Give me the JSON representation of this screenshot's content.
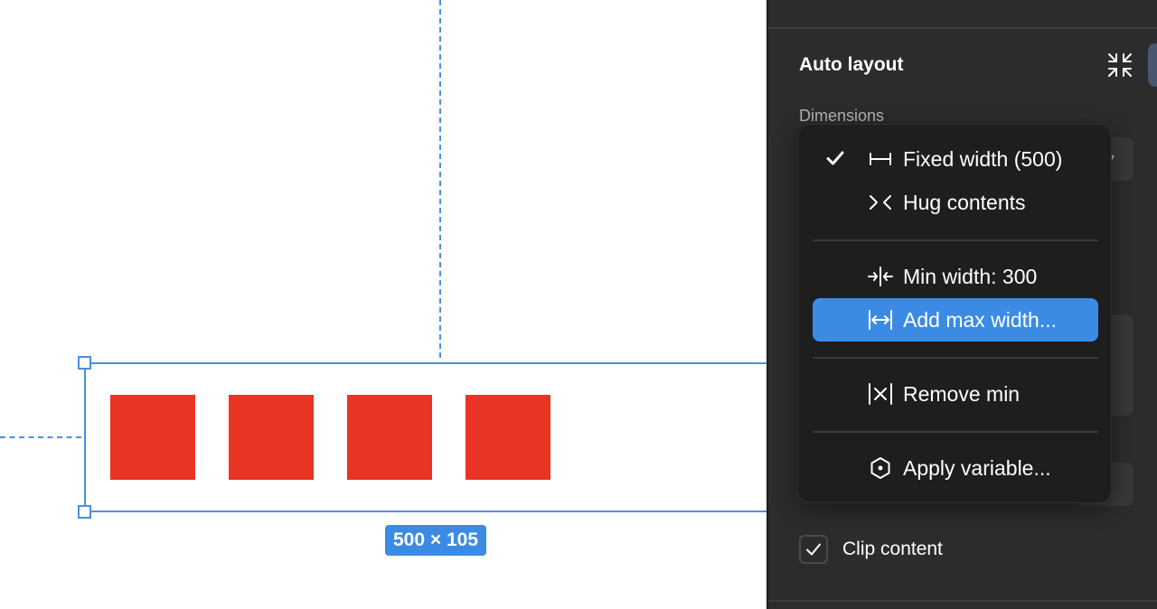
{
  "canvas": {
    "selection_size": "500 × 105",
    "fill_color": "#e93323",
    "accent_color": "#3b8be4",
    "square_count": 4
  },
  "panel": {
    "title": "Auto layout",
    "collapse_icon": "collapse-arrows-icon",
    "dimensions_label": "Dimensions",
    "clip_content": {
      "label": "Clip content",
      "checked": true
    }
  },
  "menu": {
    "items": [
      {
        "label": "Fixed width (500)",
        "icon": "fixed-width-icon",
        "checked": true
      },
      {
        "label": "Hug contents",
        "icon": "hug-contents-icon",
        "checked": false
      },
      {
        "label": "Min width: 300",
        "icon": "min-width-icon",
        "checked": false
      },
      {
        "label": "Add max width...",
        "icon": "max-width-icon",
        "checked": false,
        "highlighted": true
      },
      {
        "label": "Remove min",
        "icon": "remove-min-icon",
        "checked": false
      },
      {
        "label": "Apply variable...",
        "icon": "variable-icon",
        "checked": false
      }
    ]
  }
}
